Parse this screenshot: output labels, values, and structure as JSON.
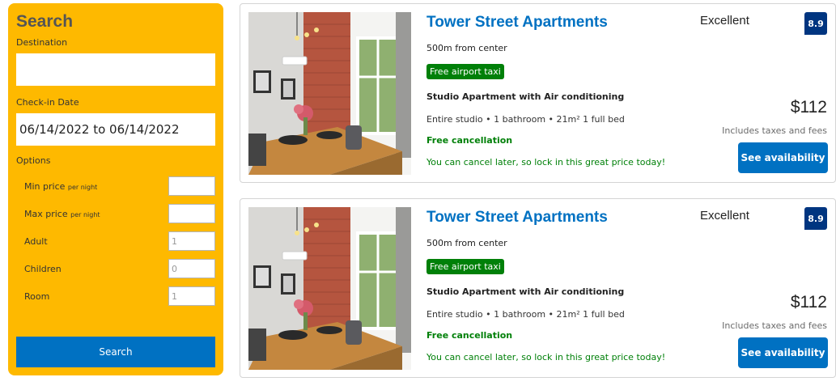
{
  "search": {
    "title": "Search",
    "destination_label": "Destination",
    "destination_value": "",
    "checkin_label": "Check-in Date",
    "checkin_value": "06/14/2022 to 06/14/2022",
    "options_label": "Options",
    "options": [
      {
        "label": "Min price",
        "sub": "per night",
        "value": ""
      },
      {
        "label": "Max price",
        "sub": "per night",
        "value": ""
      },
      {
        "label": "Adult",
        "sub": "",
        "value": "1"
      },
      {
        "label": "Children",
        "sub": "",
        "value": "0"
      },
      {
        "label": "Room",
        "sub": "",
        "value": "1"
      }
    ],
    "button_label": "Search"
  },
  "results": [
    {
      "title": "Tower Street Apartments",
      "distance": "500m from center",
      "taxi": "Free airport taxi",
      "room_type": "Studio Apartment with Air conditioning",
      "details": "Entire studio • 1 bathroom • 21m² 1 full bed",
      "cancel_title": "Free cancellation",
      "cancel_sub": "You can cancel later, so lock in this great price today!",
      "rating_word": "Excellent",
      "rating": "8.9",
      "price": "$112",
      "price_note": "Includes taxes and fees",
      "button": "See availability"
    },
    {
      "title": "Tower Street Apartments",
      "distance": "500m from center",
      "taxi": "Free airport taxi",
      "room_type": "Studio Apartment with Air conditioning",
      "details": "Entire studio • 1 bathroom • 21m² 1 full bed",
      "cancel_title": "Free cancellation",
      "cancel_sub": "You can cancel later, so lock in this great price today!",
      "rating_word": "Excellent",
      "rating": "8.9",
      "price": "$112",
      "price_note": "Includes taxes and fees",
      "button": "See availability"
    }
  ],
  "colors": {
    "panel": "#feb900",
    "primary": "#0071c2",
    "green": "#008009",
    "score": "#003580"
  }
}
